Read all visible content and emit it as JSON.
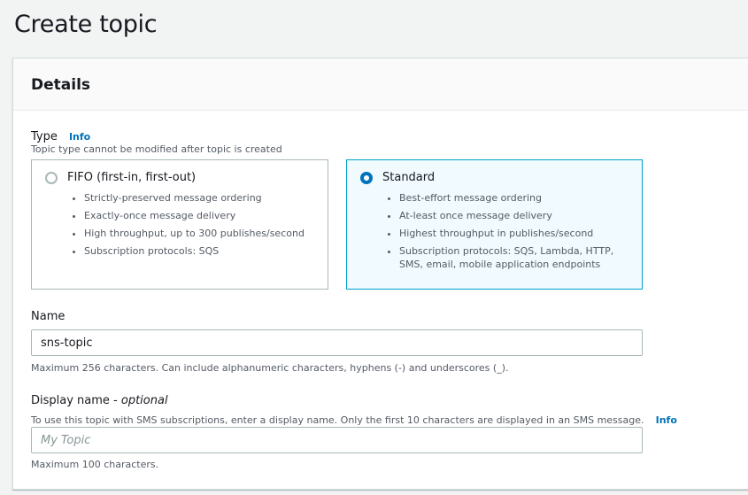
{
  "page": {
    "title": "Create topic"
  },
  "details": {
    "header": "Details",
    "type": {
      "label": "Type",
      "info": "Info",
      "hint": "Topic type cannot be modified after topic is created",
      "options": [
        {
          "title": "FIFO (first-in, first-out)",
          "selected": false,
          "bullets": [
            "Strictly-preserved message ordering",
            "Exactly-once message delivery",
            "High throughput, up to 300 publishes/second",
            "Subscription protocols: SQS"
          ]
        },
        {
          "title": "Standard",
          "selected": true,
          "bullets": [
            "Best-effort message ordering",
            "At-least once message delivery",
            "Highest throughput in publishes/second",
            "Subscription protocols: SQS, Lambda, HTTP, SMS, email, mobile application endpoints"
          ]
        }
      ]
    },
    "name": {
      "label": "Name",
      "value": "sns-topic",
      "hint": "Maximum 256 characters. Can include alphanumeric characters, hyphens (-) and underscores (_)."
    },
    "display_name": {
      "label": "Display name - ",
      "optional": "optional",
      "hint": "To use this topic with SMS subscriptions, enter a display name. Only the first 10 characters are displayed in an SMS message.",
      "info": "Info",
      "placeholder": "My Topic",
      "footer_hint": "Maximum 100 characters."
    }
  },
  "colors": {
    "accent": "#0073bb",
    "selected_tile_bg": "#f1faff",
    "selected_tile_border": "#00a1c9"
  }
}
